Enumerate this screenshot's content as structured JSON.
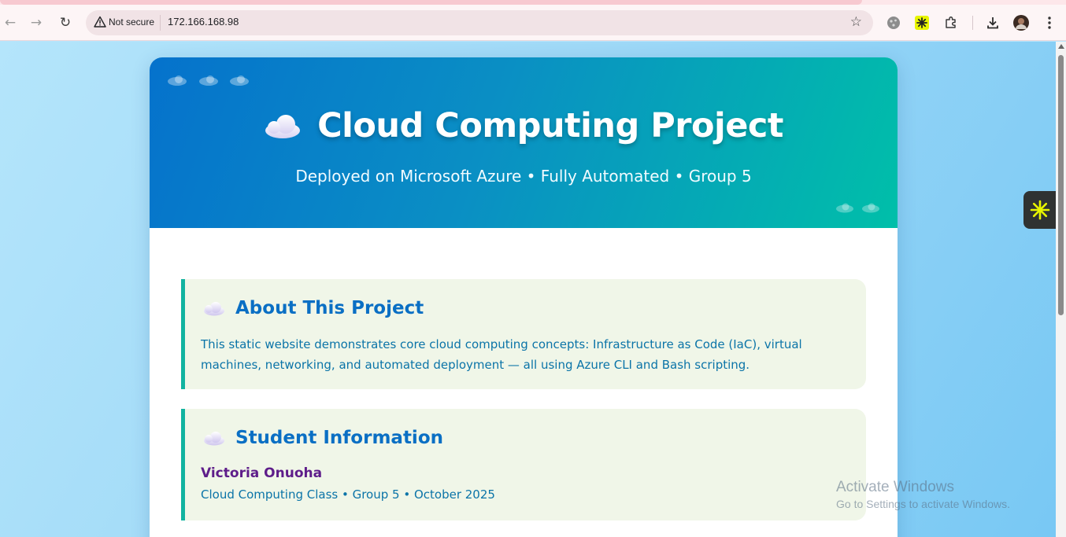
{
  "browser": {
    "security_label": "Not secure",
    "url": "172.166.168.98"
  },
  "hero": {
    "title": "Cloud Computing Project",
    "subtitle": "Deployed on Microsoft Azure • Fully Automated • Group 5"
  },
  "about": {
    "heading": "About This Project",
    "text": "This static website demonstrates core cloud computing concepts: Infrastructure as Code (IaC), virtual machines, networking, and automated deployment — all using Azure CLI and Bash scripting."
  },
  "student": {
    "heading": "Student Information",
    "name": "Victoria Onuoha",
    "meta": "Cloud Computing Class • Group 5 • October 2025"
  },
  "windows_watermark": {
    "title": "Activate Windows",
    "subtitle": "Go to Settings to activate Windows."
  },
  "icons": {
    "back": "arrow-left-icon",
    "forward": "arrow-right-icon",
    "reload": "reload-icon",
    "warning": "warning-triangle-icon",
    "star": "star-icon",
    "extensions": "puzzle-icon",
    "download": "download-icon",
    "menu": "kebab-menu-icon",
    "section": "cloud-icon"
  },
  "colors": {
    "hero_start": "#0572cc",
    "hero_end": "#00bfa9",
    "heading": "#0a6fc4",
    "name": "#5e1d8a",
    "accent_border": "#12b3a0",
    "section_bg": "#f0f6e8"
  }
}
